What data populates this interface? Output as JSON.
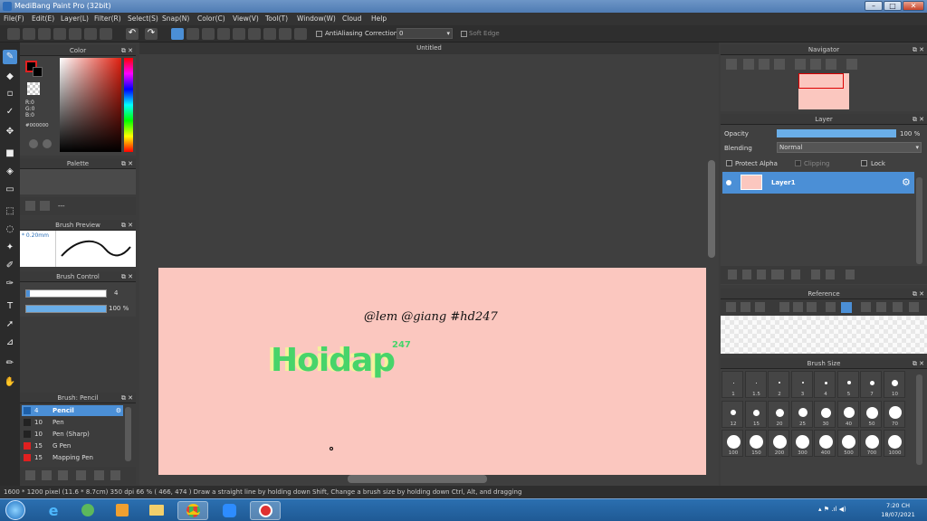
{
  "app": {
    "title": "MediBang Paint Pro (32bit)",
    "document_title": "Untitled"
  },
  "menu": [
    "File(F)",
    "Edit(E)",
    "Layer(L)",
    "Filter(R)",
    "Select(S)",
    "Snap(N)",
    "Color(C)",
    "View(V)",
    "Tool(T)",
    "Window(W)",
    "Cloud",
    "Help"
  ],
  "toolbar": {
    "antialiasing_label": "AntiAliasing",
    "correction_label": "Correction",
    "correction_value": "0",
    "soft_edge_label": "Soft Edge"
  },
  "color_panel": {
    "title": "Color",
    "r": "R:0",
    "g": "G:0",
    "b": "B:0",
    "hex": "#000000",
    "primary_color": "#000000",
    "border_color": "#e02020"
  },
  "palette_panel": {
    "title": "Palette",
    "value": "---"
  },
  "brush_preview": {
    "title": "Brush Preview",
    "size": "* 0.20mm"
  },
  "brush_control": {
    "title": "Brush Control",
    "size_value": "4",
    "opacity_value": "100 %"
  },
  "brush_list": {
    "title": "Brush: Pencil",
    "items": [
      {
        "size": "4",
        "name": "Pencil",
        "color": "#1d5fa8",
        "selected": true
      },
      {
        "size": "10",
        "name": "Pen",
        "color": "#222222",
        "selected": false
      },
      {
        "size": "10",
        "name": "Pen (Sharp)",
        "color": "#222222",
        "selected": false
      },
      {
        "size": "15",
        "name": "G Pen",
        "color": "#e02020",
        "selected": false
      },
      {
        "size": "15",
        "name": "Mapping Pen",
        "color": "#e02020",
        "selected": false
      }
    ]
  },
  "canvas": {
    "paper_color": "#fbc7bf",
    "handwriting": "@lem @giang #hd247",
    "logo_text": "Hoidap",
    "logo_sup": "247"
  },
  "navigator": {
    "title": "Navigator"
  },
  "layer_panel": {
    "title": "Layer",
    "opacity_label": "Opacity",
    "opacity_value": "100 %",
    "blending_label": "Blending",
    "blending_value": "Normal",
    "protect_alpha": "Protect Alpha",
    "clipping": "Clipping",
    "lock": "Lock",
    "layers": [
      {
        "name": "Layer1"
      }
    ]
  },
  "reference_panel": {
    "title": "Reference"
  },
  "brush_size_panel": {
    "title": "Brush Size",
    "row1": [
      "1",
      "1.5",
      "2",
      "3",
      "4",
      "5",
      "7",
      "10"
    ],
    "row2": [
      "12",
      "15",
      "20",
      "25",
      "30",
      "40",
      "50",
      "70"
    ],
    "row3": [
      "100",
      "150",
      "200",
      "300",
      "400",
      "500",
      "700",
      "1000"
    ]
  },
  "statusbar": {
    "dimensions": "1600 * 1200 pixel",
    "physical": "(11.6 * 8.7cm)",
    "dpi": "350 dpi",
    "zoom": "66 %",
    "coords": "( 466, 474 )",
    "hint": "Draw a straight line by holding down Shift, Change a brush size by holding down Ctrl, Alt, and dragging"
  },
  "taskbar": {
    "time": "7:20 CH",
    "date": "18/07/2021"
  }
}
